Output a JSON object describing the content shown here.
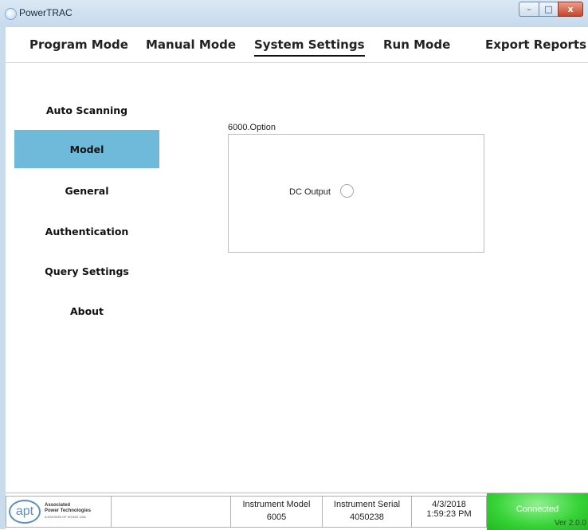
{
  "window": {
    "title": "PowerTRAC",
    "controls": {
      "minimize": "–",
      "maximize": "□",
      "close": "x"
    }
  },
  "nav": {
    "tabs": [
      {
        "label": "Program Mode"
      },
      {
        "label": "Manual Mode"
      },
      {
        "label": "System Settings",
        "active": true
      },
      {
        "label": "Run Mode"
      },
      {
        "label": "Export Reports"
      }
    ]
  },
  "sidebar": {
    "items": [
      {
        "label": "Auto Scanning"
      },
      {
        "label": "Model",
        "active": true
      },
      {
        "label": "General"
      },
      {
        "label": "Authentication"
      },
      {
        "label": "Query Settings"
      },
      {
        "label": "About"
      }
    ]
  },
  "main": {
    "group_label": "6000.Option",
    "dc_output_label": "DC Output",
    "dc_output_checked": false
  },
  "status": {
    "logo": {
      "mark": "apt",
      "line1": "Associated",
      "line2": "Power Technologies",
      "line3": "A DIVISION OF IKONIX USA"
    },
    "instrument_model_label": "Instrument Model",
    "instrument_model_value": "6005",
    "instrument_serial_label": "Instrument Serial",
    "instrument_serial_value": "4050238",
    "date": "4/3/2018",
    "time": "1:59:23 PM",
    "connection": "Connected",
    "version": "Ver 2.0.0"
  },
  "colors": {
    "sidebar_active": "#6fb9db",
    "connected": "#36d236",
    "titlebar": "#c6d9ec"
  }
}
